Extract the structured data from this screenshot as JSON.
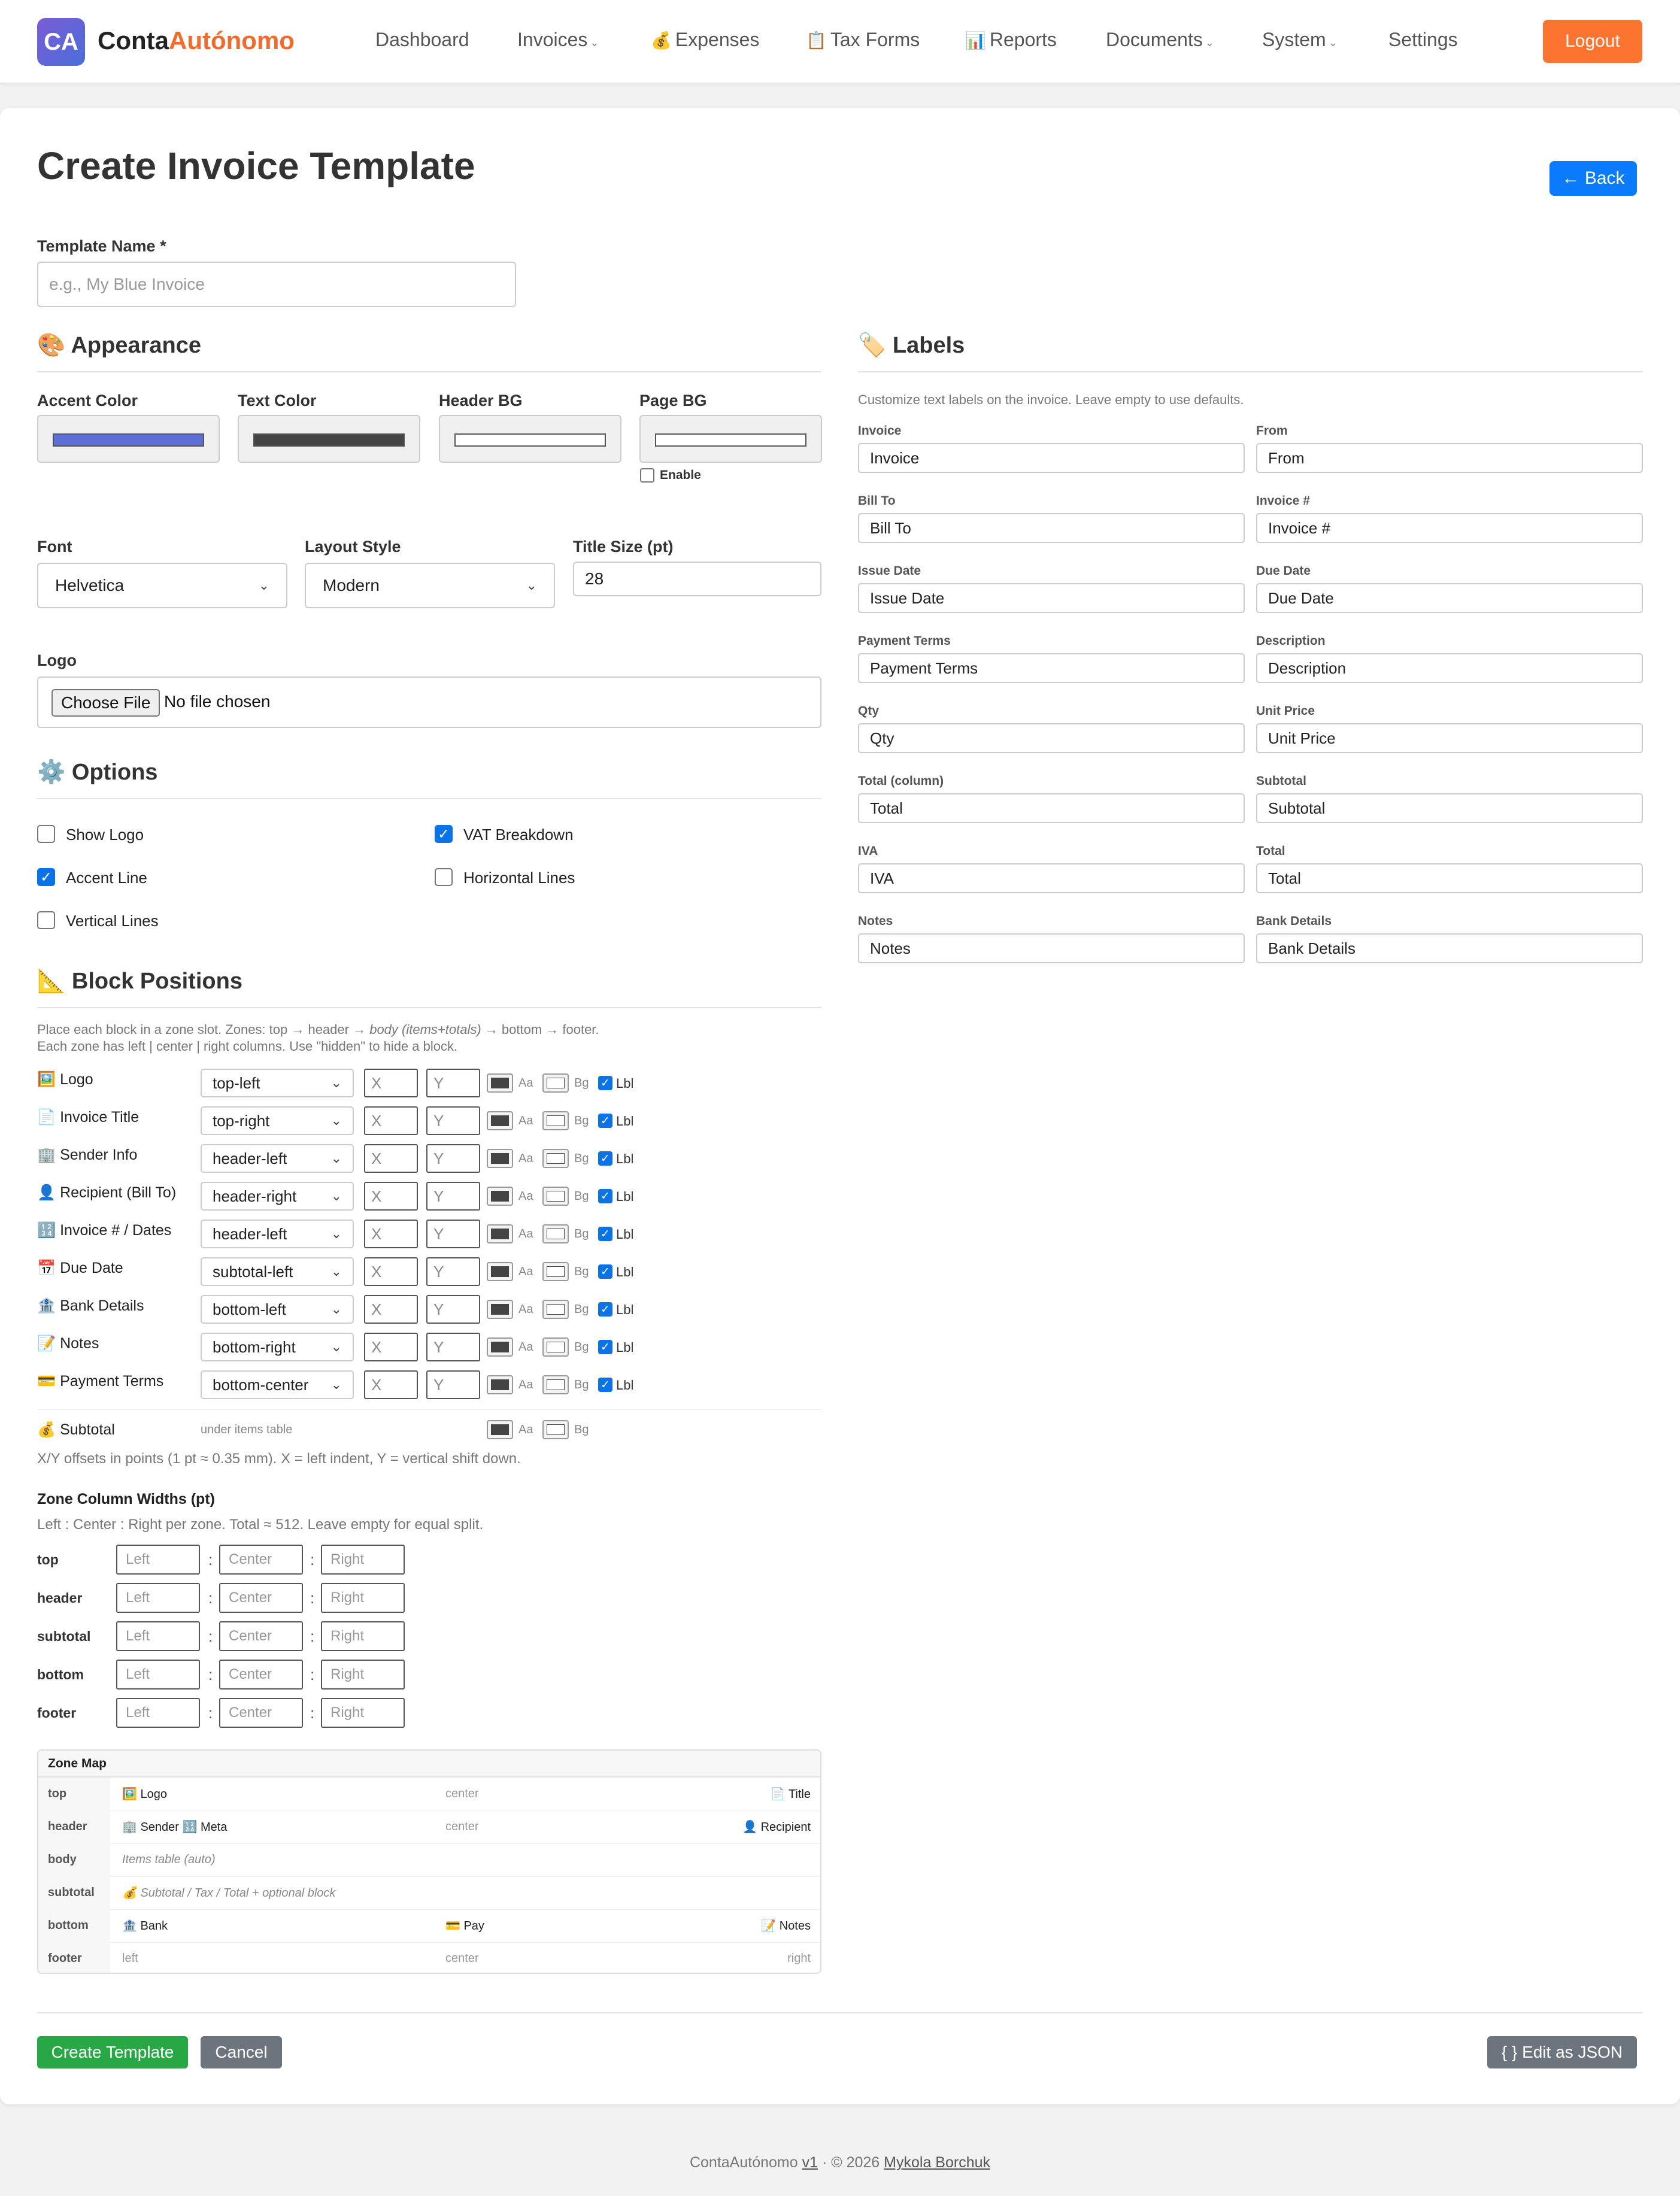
{
  "brand": {
    "badge": "CA",
    "name_main": "Conta",
    "name_accent": "Autónomo"
  },
  "nav": {
    "items": [
      {
        "label": "Dashboard",
        "icon": "",
        "dropdown": false
      },
      {
        "label": "Invoices",
        "icon": "",
        "dropdown": true
      },
      {
        "label": "Expenses",
        "icon": "💰",
        "dropdown": false
      },
      {
        "label": "Tax Forms",
        "icon": "📋",
        "dropdown": false
      },
      {
        "label": "Reports",
        "icon": "📊",
        "dropdown": false
      },
      {
        "label": "Documents",
        "icon": "",
        "dropdown": true
      },
      {
        "label": "System",
        "icon": "",
        "dropdown": true
      },
      {
        "label": "Settings",
        "icon": "",
        "dropdown": false
      }
    ],
    "logout": "Logout"
  },
  "page": {
    "title": "Create Invoice Template",
    "back": "← Back"
  },
  "template_name": {
    "label": "Template Name *",
    "placeholder": "e.g., My Blue Invoice"
  },
  "appearance": {
    "title": "Appearance",
    "icon": "🎨",
    "colors": [
      {
        "label": "Accent Color",
        "value": "#5b6fd6"
      },
      {
        "label": "Text Color",
        "value": "#444444"
      },
      {
        "label": "Header BG",
        "value": "#ffffff"
      },
      {
        "label": "Page BG",
        "value": "#ffffff"
      }
    ],
    "page_bg_enable": "Enable",
    "font": {
      "label": "Font",
      "value": "Helvetica"
    },
    "layout_style": {
      "label": "Layout Style",
      "value": "Modern"
    },
    "title_size": {
      "label": "Title Size (pt)",
      "value": "28"
    },
    "logo": {
      "label": "Logo",
      "button": "Choose File",
      "status": "No file chosen"
    }
  },
  "options": {
    "title": "Options",
    "icon": "⚙️",
    "items": [
      {
        "label": "Show Logo",
        "checked": false
      },
      {
        "label": "VAT Breakdown",
        "checked": true
      },
      {
        "label": "Accent Line",
        "checked": true
      },
      {
        "label": "Horizontal Lines",
        "checked": false
      },
      {
        "label": "Vertical Lines",
        "checked": false
      }
    ]
  },
  "block_positions": {
    "title": "Block Positions",
    "icon": "📐",
    "help_line1_a": "Place each block in a zone slot. Zones: top → header → ",
    "help_line1_i": "body (items+totals)",
    "help_line1_b": " → bottom → footer.",
    "help_line2": "Each zone has left | center | right columns. Use \"hidden\" to hide a block.",
    "x_placeholder": "X",
    "y_placeholder": "Y",
    "aa": "Aa",
    "bg": "Bg",
    "lbl": "Lbl",
    "text_color": "#444444",
    "rows": [
      {
        "icon": "🖼️",
        "name": "Logo",
        "zone": "top-left"
      },
      {
        "icon": "📄",
        "name": "Invoice Title",
        "zone": "top-right"
      },
      {
        "icon": "🏢",
        "name": "Sender Info",
        "zone": "header-left"
      },
      {
        "icon": "👤",
        "name": "Recipient (Bill To)",
        "zone": "header-right"
      },
      {
        "icon": "🔢",
        "name": "Invoice # / Dates",
        "zone": "header-left"
      },
      {
        "icon": "📅",
        "name": "Due Date",
        "zone": "subtotal-left"
      },
      {
        "icon": "🏦",
        "name": "Bank Details",
        "zone": "bottom-left"
      },
      {
        "icon": "📝",
        "name": "Notes",
        "zone": "bottom-right"
      },
      {
        "icon": "💳",
        "name": "Payment Terms",
        "zone": "bottom-center"
      }
    ],
    "subtotal": {
      "icon": "💰",
      "name": "Subtotal",
      "note": "under items table"
    },
    "offset_help": "X/Y offsets in points (1 pt ≈ 0.35 mm). X = left indent, Y = vertical shift down."
  },
  "zone_widths": {
    "title": "Zone Column Widths (pt)",
    "help": "Left : Center : Right per zone. Total ≈ 512. Leave empty for equal split.",
    "placeholders": {
      "left": "Left",
      "center": "Center",
      "right": "Right"
    },
    "zones": [
      "top",
      "header",
      "subtotal",
      "bottom",
      "footer"
    ]
  },
  "zone_map": {
    "title": "Zone Map",
    "rows": [
      {
        "zone": "top",
        "left": "🖼️ Logo",
        "center": "center",
        "right": "📄 Title"
      },
      {
        "zone": "header",
        "left": "🏢 Sender 🔢 Meta",
        "center": "center",
        "right": "👤 Recipient"
      },
      {
        "zone": "body",
        "full": "Items table (auto)"
      },
      {
        "zone": "subtotal",
        "full": "💰 Subtotal / Tax / Total + optional block"
      },
      {
        "zone": "bottom",
        "left": "🏦 Bank",
        "center": "💳 Pay",
        "right": "📝 Notes"
      },
      {
        "zone": "footer",
        "left": "left",
        "center": "center",
        "right": "right"
      }
    ]
  },
  "labels": {
    "title": "Labels",
    "icon": "🏷️",
    "help": "Customize text labels on the invoice. Leave empty to use defaults.",
    "fields": [
      {
        "label": "Invoice",
        "value": "Invoice"
      },
      {
        "label": "From",
        "value": "From"
      },
      {
        "label": "Bill To",
        "value": "Bill To"
      },
      {
        "label": "Invoice #",
        "value": "Invoice #"
      },
      {
        "label": "Issue Date",
        "value": "Issue Date"
      },
      {
        "label": "Due Date",
        "value": "Due Date"
      },
      {
        "label": "Payment Terms",
        "value": "Payment Terms"
      },
      {
        "label": "Description",
        "value": "Description"
      },
      {
        "label": "Qty",
        "value": "Qty"
      },
      {
        "label": "Unit Price",
        "value": "Unit Price"
      },
      {
        "label": "Total (column)",
        "value": "Total"
      },
      {
        "label": "Subtotal",
        "value": "Subtotal"
      },
      {
        "label": "IVA",
        "value": "IVA"
      },
      {
        "label": "Total",
        "value": "Total"
      },
      {
        "label": "Notes",
        "value": "Notes"
      },
      {
        "label": "Bank Details",
        "value": "Bank Details"
      }
    ]
  },
  "actions": {
    "create": "Create Template",
    "cancel": "Cancel",
    "json": "{ } Edit as JSON"
  },
  "footer": {
    "app": "ContaAutónomo",
    "version": "v1",
    "copyright": "· © 2026",
    "author": "Mykola Borchuk"
  },
  "colors": {
    "primary": "#0a7bff",
    "logout": "#fd7330",
    "create": "#28a745",
    "secondary": "#6c757d"
  }
}
